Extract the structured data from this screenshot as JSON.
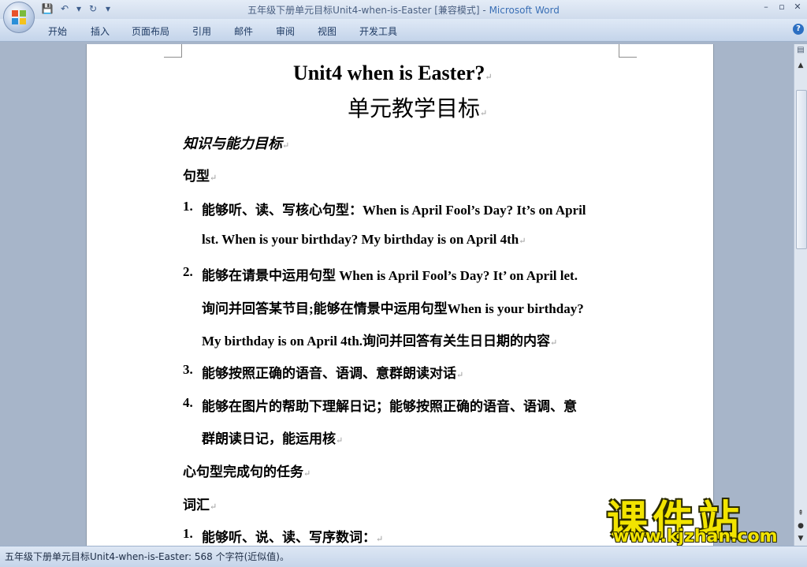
{
  "window": {
    "title": "五年级下册单元目标Unit4-when-is-Easter [兼容模式]",
    "separator": " - ",
    "app": "Microsoft Word"
  },
  "ribbon": {
    "tabs": [
      "开始",
      "插入",
      "页面布局",
      "引用",
      "邮件",
      "审阅",
      "视图",
      "开发工具"
    ]
  },
  "document": {
    "title": "Unit4 when is Easter?",
    "subtitle": "单元教学目标",
    "section_heading": "知识与能力目标",
    "sentence_heading": "句型",
    "items": [
      {
        "num": "1.",
        "line1": "能够听、读、写核心句型：When is April Fool’s Day? It’s on April",
        "line2": "lst. When is your birthday? My birthday is on April 4th"
      },
      {
        "num": "2.",
        "line1": "能够在请景中运用句型 When is April Fool’s Day? It’ on April let.",
        "line2": "询问并回答某节目;能够在情景中运用句型When is your birthday?",
        "line3": "My birthday is on April 4th.询问并回答有关生日日期的内容"
      },
      {
        "num": "3.",
        "line1": "能够按照正确的语音、语调、意群朗读对话"
      },
      {
        "num": "4.",
        "line1": "能够在图片的帮助下理解日记；能够按照正确的语音、语调、意",
        "line2": "群朗读日记，能运用核"
      }
    ],
    "task_line": "心句型完成句的任务",
    "vocab_heading": "词汇",
    "vocab_item": {
      "num": "1.",
      "line1": "能够听、说、读、写序数词："
    }
  },
  "paragraph_mark": "↵",
  "status": {
    "text": "五年级下册单元目标Unit4-when-is-Easter: 568 个字符(近似值)。"
  },
  "watermark": {
    "brand": "课件站",
    "url": "www.kjzhan.com"
  },
  "icons": [
    "office-logo-icon",
    "save-icon",
    "undo-icon",
    "redo-icon",
    "customize-icon",
    "minimize-icon",
    "restore-icon",
    "help-icon",
    "view-ruler-icon",
    "scroll-up-icon",
    "scroll-down-icon"
  ]
}
